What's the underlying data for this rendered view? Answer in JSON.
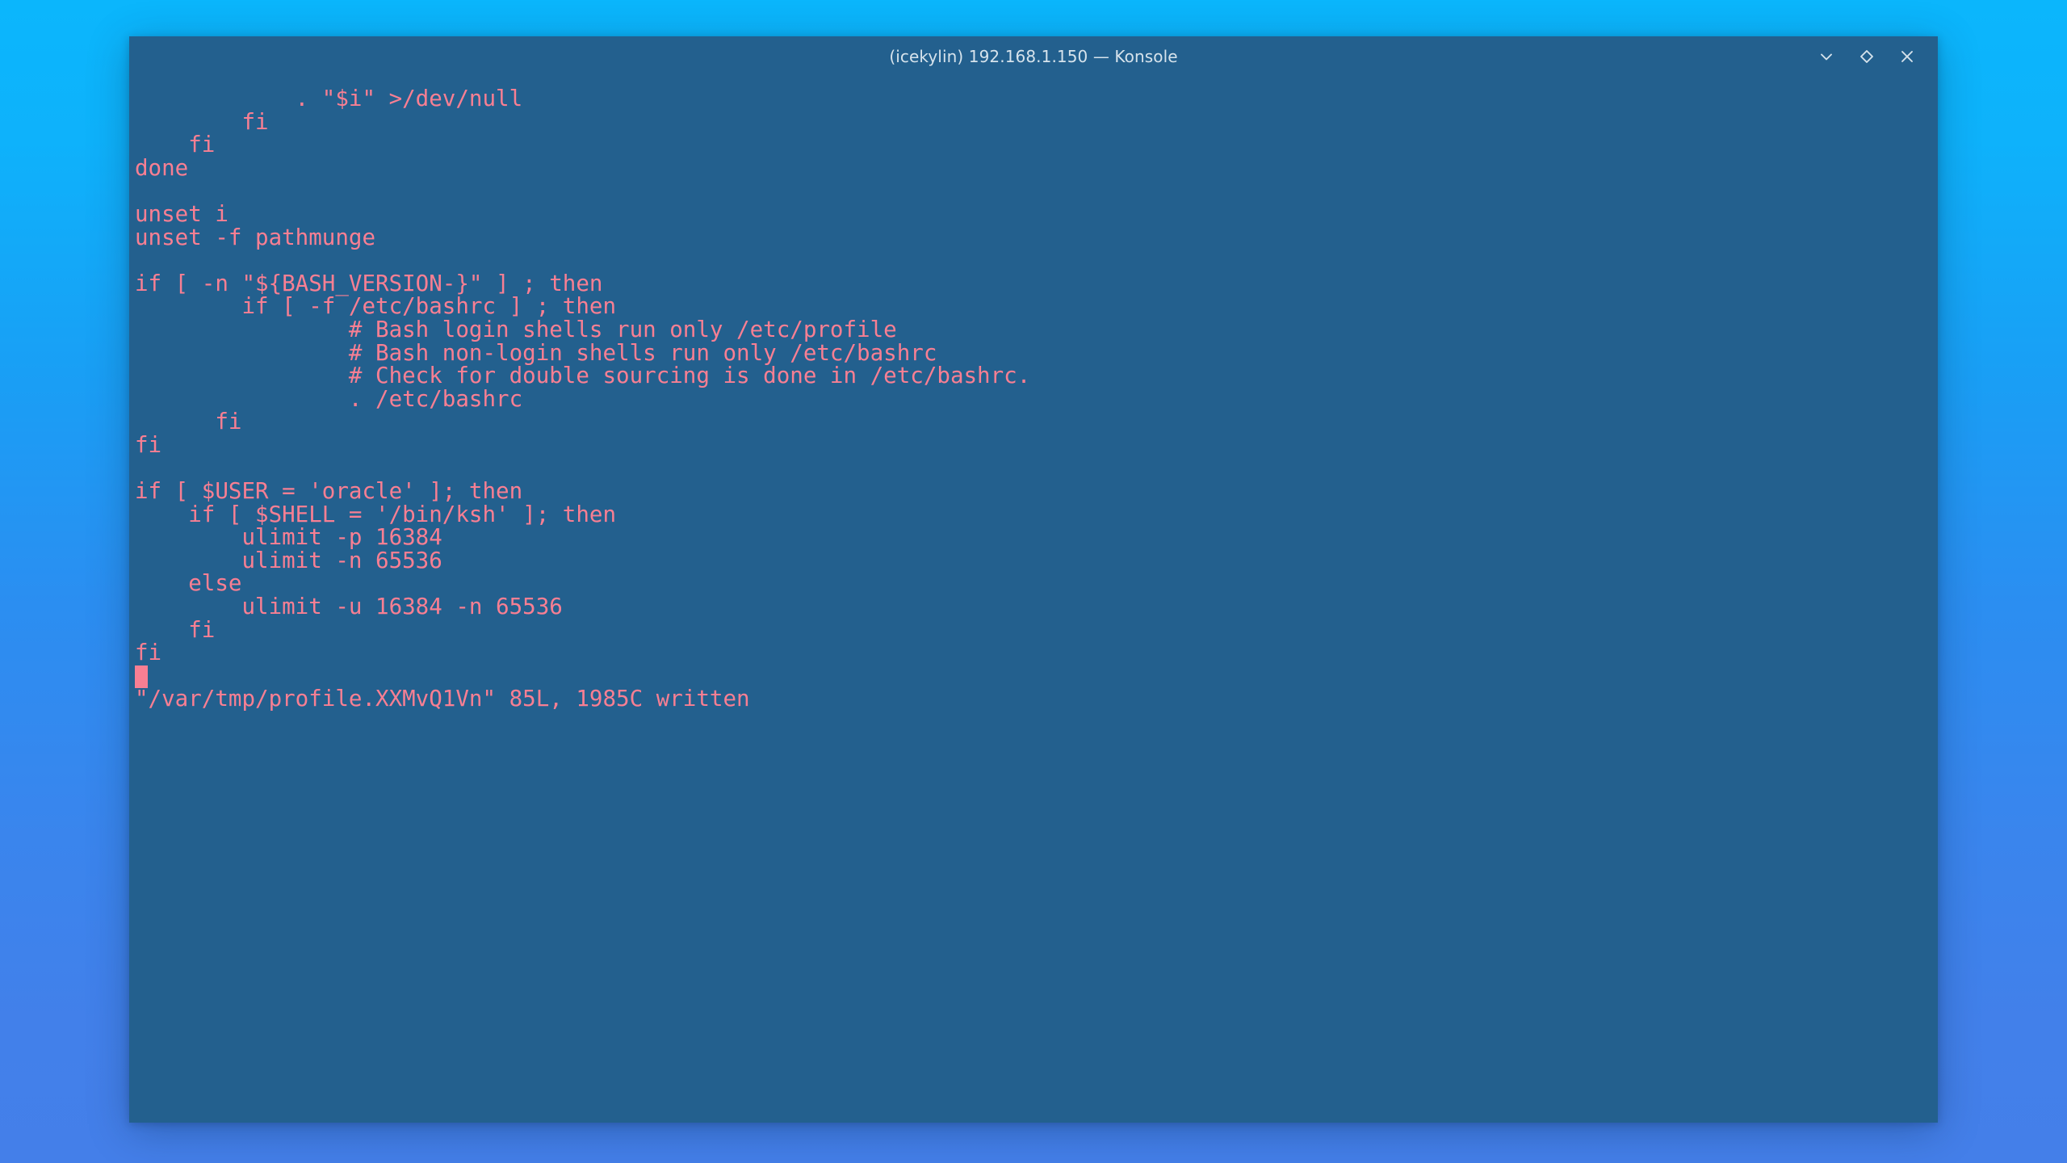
{
  "desktop": {
    "gradient_top": "#0bb6fc",
    "gradient_bottom": "#4480ea"
  },
  "window": {
    "title": "(icekylin) 192.168.1.150 — Konsole",
    "titlebar_bg": "#23608e",
    "controls": [
      {
        "name": "minimize",
        "glyph": "chevron-down"
      },
      {
        "name": "maximize",
        "glyph": "diamond"
      },
      {
        "name": "close",
        "glyph": "x"
      }
    ]
  },
  "terminal": {
    "background": "#23608e",
    "foreground": "#f87f93",
    "cursor_color": "#f87f93",
    "lines": [
      "            . \"$i\" >/dev/null",
      "        fi",
      "    fi",
      "done",
      "",
      "unset i",
      "unset -f pathmunge",
      "",
      "if [ -n \"${BASH_VERSION-}\" ] ; then",
      "        if [ -f /etc/bashrc ] ; then",
      "                # Bash login shells run only /etc/profile",
      "                # Bash non-login shells run only /etc/bashrc",
      "                # Check for double sourcing is done in /etc/bashrc.",
      "                . /etc/bashrc",
      "      fi",
      "fi",
      "",
      "if [ $USER = 'oracle' ]; then",
      "    if [ $SHELL = '/bin/ksh' ]; then",
      "        ulimit -p 16384",
      "        ulimit -n 65536",
      "    else",
      "        ulimit -u 16384 -n 65536",
      "    fi",
      "fi"
    ],
    "status_line": "\"/var/tmp/profile.XXMvQ1Vn\" 85L, 1985C written"
  }
}
